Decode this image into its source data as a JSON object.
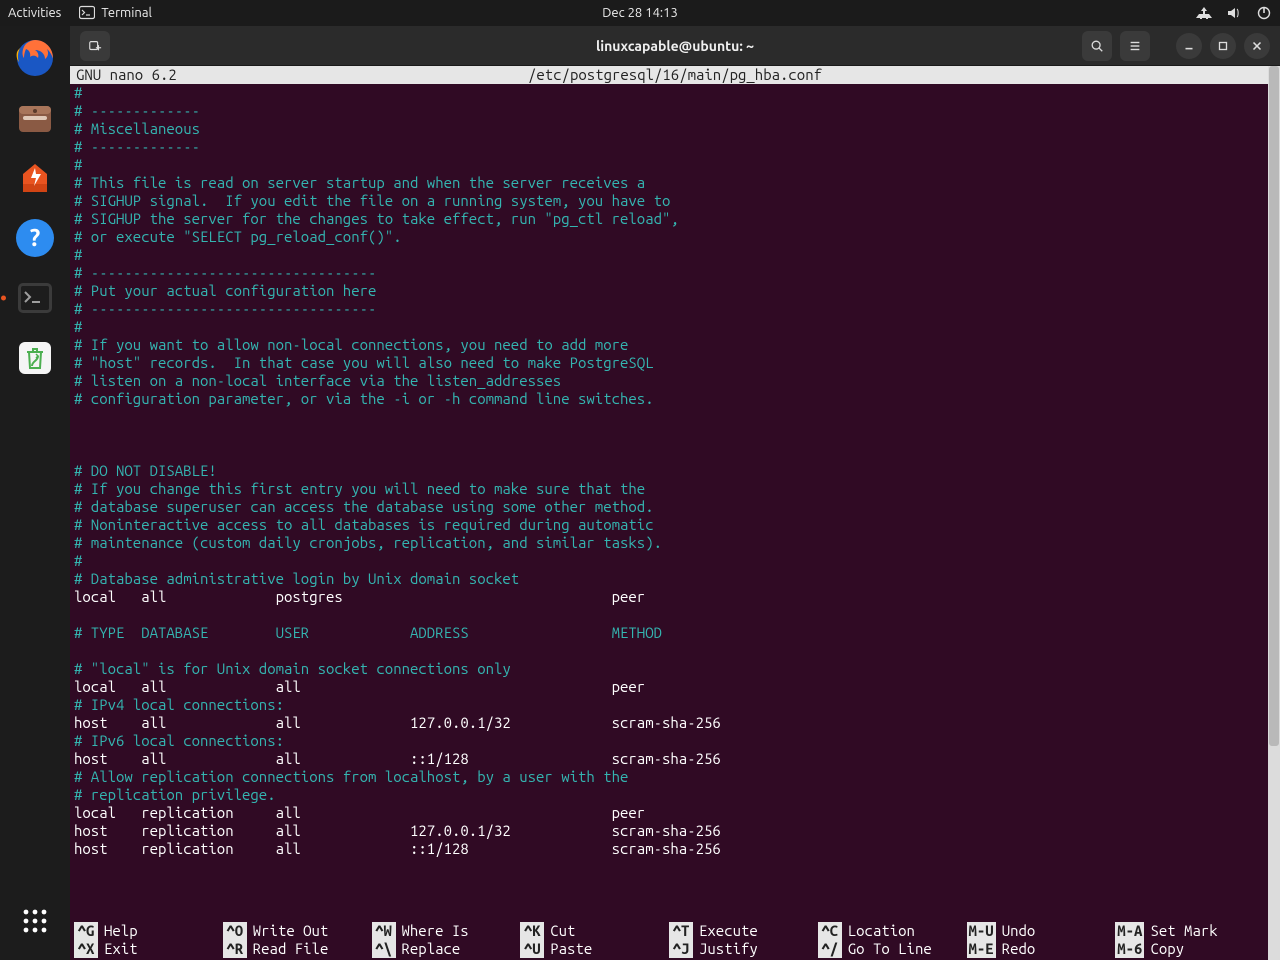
{
  "topbar": {
    "activities": "Activities",
    "app_label": "Terminal",
    "clock": "Dec 28  14:13"
  },
  "dock": {
    "items": [
      {
        "name": "firefox"
      },
      {
        "name": "files"
      },
      {
        "name": "software"
      },
      {
        "name": "help"
      },
      {
        "name": "terminal",
        "active": true
      },
      {
        "name": "trash"
      }
    ]
  },
  "window": {
    "title": "linuxcapable@ubuntu: ~"
  },
  "nano": {
    "app": "GNU nano 6.2",
    "file": "/etc/postgresql/16/main/pg_hba.conf"
  },
  "lines": [
    {
      "t": "#",
      "c": true
    },
    {
      "t": "# -------------",
      "c": true
    },
    {
      "t": "# Miscellaneous",
      "c": true
    },
    {
      "t": "# -------------",
      "c": true
    },
    {
      "t": "#",
      "c": true
    },
    {
      "t": "# This file is read on server startup and when the server receives a",
      "c": true
    },
    {
      "t": "# SIGHUP signal.  If you edit the file on a running system, you have to",
      "c": true
    },
    {
      "t": "# SIGHUP the server for the changes to take effect, run \"pg_ctl reload\",",
      "c": true
    },
    {
      "t": "# or execute \"SELECT pg_reload_conf()\".",
      "c": true
    },
    {
      "t": "#",
      "c": true
    },
    {
      "t": "# ----------------------------------",
      "c": true
    },
    {
      "t": "# Put your actual configuration here",
      "c": true
    },
    {
      "t": "# ----------------------------------",
      "c": true
    },
    {
      "t": "#",
      "c": true
    },
    {
      "t": "# If you want to allow non-local connections, you need to add more",
      "c": true
    },
    {
      "t": "# \"host\" records.  In that case you will also need to make PostgreSQL",
      "c": true
    },
    {
      "t": "# listen on a non-local interface via the listen_addresses",
      "c": true
    },
    {
      "t": "# configuration parameter, or via the -i or -h command line switches.",
      "c": true
    },
    {
      "t": "",
      "c": false
    },
    {
      "t": "",
      "c": false
    },
    {
      "t": "",
      "c": false
    },
    {
      "t": "# DO NOT DISABLE!",
      "c": true
    },
    {
      "t": "# If you change this first entry you will need to make sure that the",
      "c": true
    },
    {
      "t": "# database superuser can access the database using some other method.",
      "c": true
    },
    {
      "t": "# Noninteractive access to all databases is required during automatic",
      "c": true
    },
    {
      "t": "# maintenance (custom daily cronjobs, replication, and similar tasks).",
      "c": true
    },
    {
      "t": "#",
      "c": true
    },
    {
      "t": "# Database administrative login by Unix domain socket",
      "c": true
    },
    {
      "t": "local   all             postgres                                peer",
      "c": false
    },
    {
      "t": "",
      "c": false
    },
    {
      "t": "# TYPE  DATABASE        USER            ADDRESS                 METHOD",
      "c": true
    },
    {
      "t": "",
      "c": false
    },
    {
      "t": "# \"local\" is for Unix domain socket connections only",
      "c": true
    },
    {
      "t": "local   all             all                                     peer",
      "c": false
    },
    {
      "t": "# IPv4 local connections:",
      "c": true
    },
    {
      "t": "host    all             all             127.0.0.1/32            scram-sha-256",
      "c": false
    },
    {
      "t": "# IPv6 local connections:",
      "c": true
    },
    {
      "t": "host    all             all             ::1/128                 scram-sha-256",
      "c": false
    },
    {
      "t": "# Allow replication connections from localhost, by a user with the",
      "c": true
    },
    {
      "t": "# replication privilege.",
      "c": true
    },
    {
      "t": "local   replication     all                                     peer",
      "c": false
    },
    {
      "t": "host    replication     all             127.0.0.1/32            scram-sha-256",
      "c": false
    },
    {
      "t": "host    replication     all             ::1/128                 scram-sha-256",
      "c": false
    }
  ],
  "shortcuts_row1": [
    {
      "k": "^G",
      "l": "Help"
    },
    {
      "k": "^O",
      "l": "Write Out"
    },
    {
      "k": "^W",
      "l": "Where Is"
    },
    {
      "k": "^K",
      "l": "Cut"
    },
    {
      "k": "^T",
      "l": "Execute"
    },
    {
      "k": "^C",
      "l": "Location"
    },
    {
      "k": "M-U",
      "l": "Undo"
    },
    {
      "k": "M-A",
      "l": "Set Mark"
    }
  ],
  "shortcuts_row2": [
    {
      "k": "^X",
      "l": "Exit"
    },
    {
      "k": "^R",
      "l": "Read File"
    },
    {
      "k": "^\\",
      "l": "Replace"
    },
    {
      "k": "^U",
      "l": "Paste"
    },
    {
      "k": "^J",
      "l": "Justify"
    },
    {
      "k": "^/",
      "l": "Go To Line"
    },
    {
      "k": "M-E",
      "l": "Redo"
    },
    {
      "k": "M-6",
      "l": "Copy"
    }
  ]
}
